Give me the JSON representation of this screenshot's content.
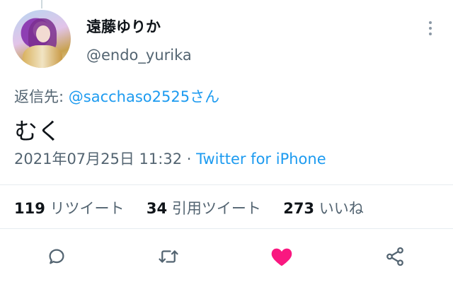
{
  "user": {
    "display_name": "遠藤ゆりか",
    "handle": "@endo_yurika"
  },
  "reply": {
    "prefix": "返信先: ",
    "mention": "@sacchaso2525さん"
  },
  "tweet": {
    "text": "むく",
    "timestamp": "2021年07月25日 11:32",
    "separator": " · ",
    "source": "Twitter for iPhone"
  },
  "stats": {
    "retweets_count": "119",
    "retweets_label": "リツイート",
    "quotes_count": "34",
    "quotes_label": "引用ツイート",
    "likes_count": "273",
    "likes_label": "いいね"
  },
  "actions": [
    {
      "icon": "reply-icon"
    },
    {
      "icon": "retweet-icon"
    },
    {
      "icon": "heart-icon",
      "liked": true
    },
    {
      "icon": "share-icon"
    }
  ],
  "colors": {
    "accent": "#1d9bf0",
    "like": "#f91880",
    "secondary_text": "#536471",
    "icon": "#536471"
  }
}
